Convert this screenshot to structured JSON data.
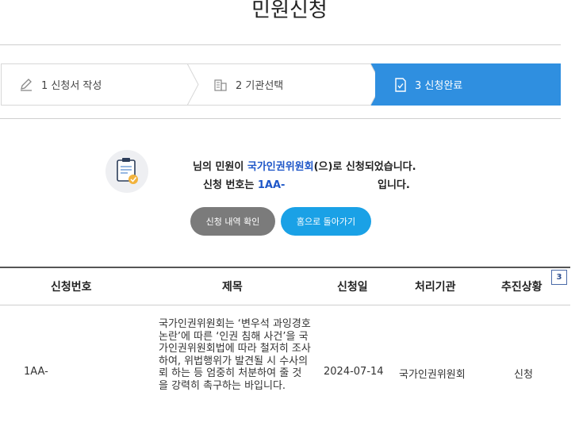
{
  "page": {
    "title": "민원신청"
  },
  "steps": [
    {
      "label": "1 신청서 작성",
      "icon": "pencil-icon",
      "state": "done"
    },
    {
      "label": "2 기관선택",
      "icon": "building-icon",
      "state": "done"
    },
    {
      "label": "3 신청완료",
      "icon": "document-check-icon",
      "state": "active"
    }
  ],
  "completion": {
    "line1_prefix": "님의 민원이 ",
    "agency": "국가인권위원회",
    "line1_suffix": "(으)로 신청되었습니다.",
    "line2_prefix": "신청 번호는 ",
    "application_no": "1AA-",
    "line2_suffix": "입니다."
  },
  "buttons": {
    "view_history": "신청 내역 확인",
    "go_home": "홈으로 돌아가기"
  },
  "table": {
    "headers": [
      "신청번호",
      "제목",
      "신청일",
      "처리기관",
      "추진상황"
    ],
    "rows": [
      {
        "no": "1AA-",
        "title": "국가인권위원회는 ‘변우석 과잉경호 논란’에 따른 ‘인권 침해 사건’을 국가인권위원회법에 따라 철저히 조사하여, 위법행위가 발견될 시 수사의뢰 하는 등 엄중히 처분하여 줄 것을 강력히 촉구하는 바입니다.",
        "date": "2024-07-14",
        "agency": "국가인권위원회",
        "status": "신청"
      }
    ]
  },
  "badge": "3",
  "colors": {
    "accent": "#2f8fe0",
    "button_blue": "#1aa1e6",
    "button_gray": "#7b7b7b",
    "highlight": "#1f57c8"
  }
}
